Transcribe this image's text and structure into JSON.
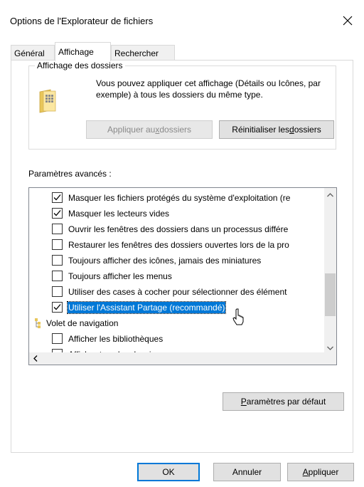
{
  "window": {
    "title": "Options de l'Explorateur de fichiers",
    "close_glyph": "✕"
  },
  "tabs": [
    {
      "label": "Général",
      "active": false
    },
    {
      "label": "Affichage",
      "active": true
    },
    {
      "label": "Rechercher",
      "active": false
    }
  ],
  "folder_view": {
    "legend": "Affichage des dossiers",
    "description": "Vous pouvez appliquer cet affichage (Détails ou Icônes, par exemple) à tous les dossiers du même type.",
    "apply_label": {
      "pre": "Appliquer au",
      "u": "x",
      "post": " dossiers"
    },
    "reset_label": {
      "pre": "Réinitialiser les ",
      "u": "d",
      "post": "ossiers"
    }
  },
  "advanced": {
    "label": "Paramètres avancés :",
    "items": [
      {
        "type": "checkbox",
        "checked": true,
        "label": "Masquer les fichiers protégés du système d'exploitation (re"
      },
      {
        "type": "checkbox",
        "checked": true,
        "label": "Masquer les lecteurs vides"
      },
      {
        "type": "checkbox",
        "checked": false,
        "label": "Ouvrir les fenêtres des dossiers dans un processus différe"
      },
      {
        "type": "checkbox",
        "checked": false,
        "label": "Restaurer les fenêtres des dossiers ouvertes lors de la pro"
      },
      {
        "type": "checkbox",
        "checked": false,
        "label": "Toujours afficher des icônes, jamais des miniatures"
      },
      {
        "type": "checkbox",
        "checked": false,
        "label": "Toujours afficher les menus"
      },
      {
        "type": "checkbox",
        "checked": false,
        "label": "Utiliser des cases à cocher pour sélectionner des élément"
      },
      {
        "type": "checkbox",
        "checked": true,
        "selected": true,
        "label": "Utiliser l'Assistant Partage (recommandé)"
      },
      {
        "type": "group",
        "label": "Volet de navigation",
        "icon": "navigation-pane-icon"
      },
      {
        "type": "checkbox",
        "checked": false,
        "label": "Afficher les bibliothèques"
      },
      {
        "type": "checkbox",
        "checked": false,
        "label": "Afficher tous les dossiers"
      }
    ]
  },
  "defaults_button": {
    "pre": "",
    "u": "P",
    "post": "aramètres par défaut"
  },
  "footer": {
    "ok": "OK",
    "cancel": "Annuler",
    "apply": {
      "pre": "",
      "u": "A",
      "post": "ppliquer"
    }
  }
}
